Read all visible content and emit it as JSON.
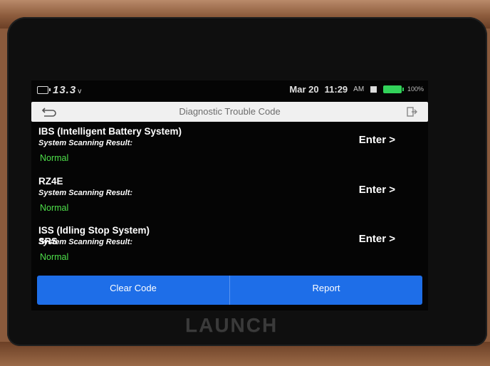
{
  "status_bar": {
    "voltage": "13.3",
    "voltage_unit": "v",
    "date": "Mar 20",
    "time": "11:29",
    "time_suffix": "AM",
    "battery_percent": "100%"
  },
  "header": {
    "title": "Diagnostic Trouble Code"
  },
  "systems": [
    {
      "name": "IBS (Intelligent Battery System)",
      "result_label": "System Scanning Result:",
      "result_value": "Normal",
      "enter_label": "Enter >"
    },
    {
      "name": "RZ4E",
      "result_label": "System Scanning Result:",
      "result_value": "Normal",
      "enter_label": "Enter >"
    },
    {
      "name": "ISS (Idling Stop System)",
      "result_label": "System Scanning Result:",
      "result_value": "Normal",
      "enter_label": "Enter >"
    }
  ],
  "partial_item_text": "SRS",
  "actions": {
    "clear_code_label": "Clear Code",
    "report_label": "Report"
  },
  "brand": "LAUNCH",
  "icons": {
    "vehicle_battery": "battery-vehicle-icon",
    "wifi": "wifi-icon",
    "battery": "battery-icon",
    "back": "back-arrow-icon",
    "exit": "exit-icon"
  },
  "colors": {
    "accent_blue": "#1e6ee8",
    "normal_green": "#4ee04a",
    "battery_green": "#32d25a"
  }
}
